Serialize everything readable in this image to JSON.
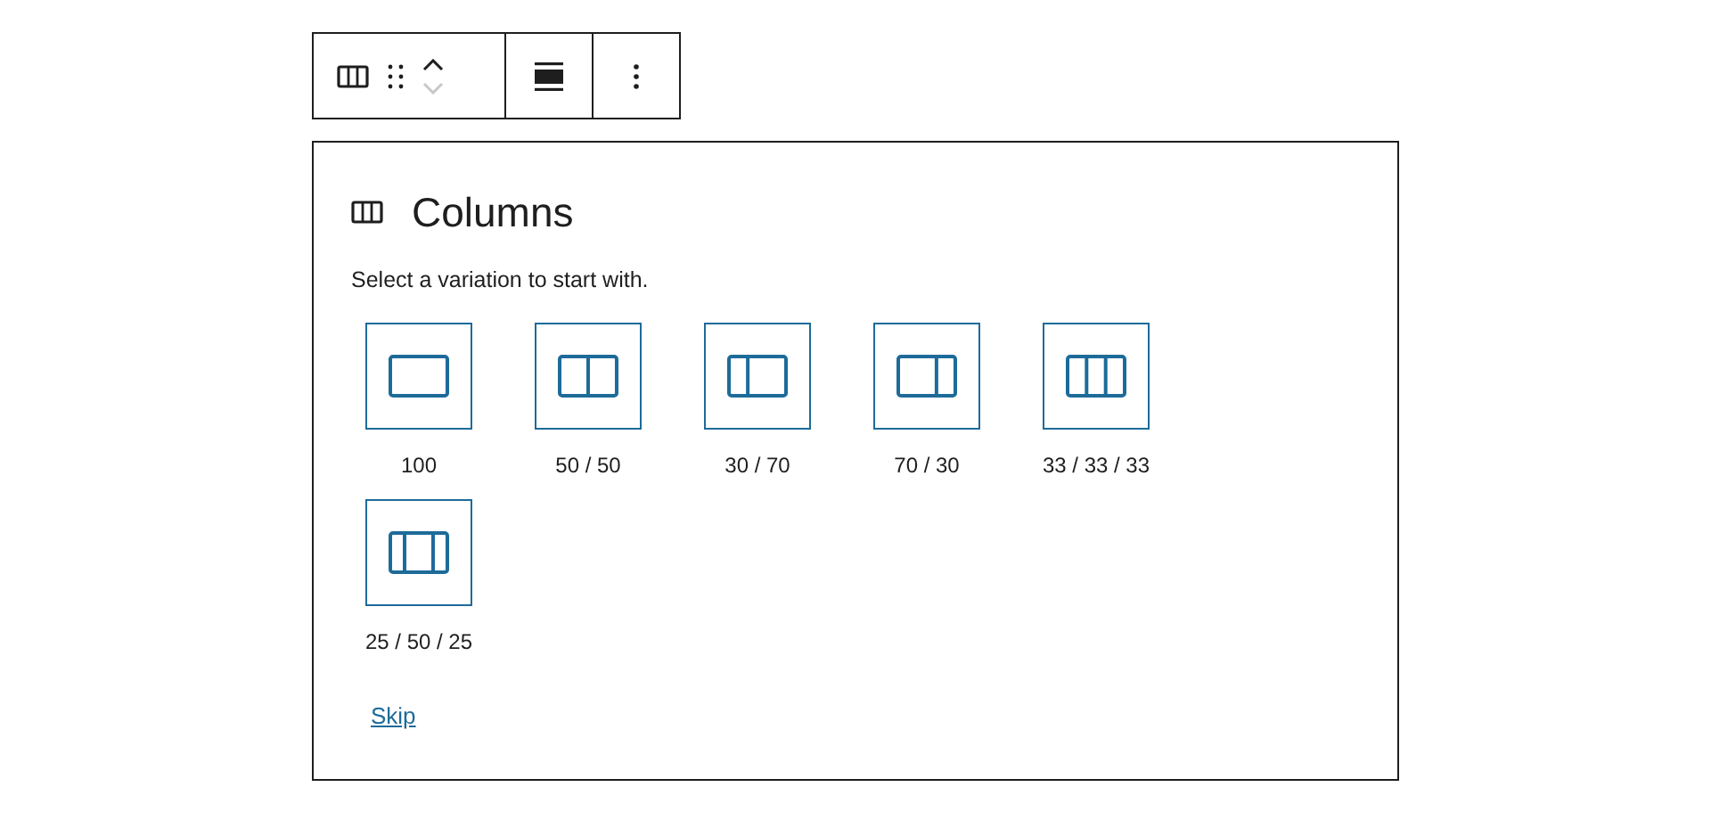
{
  "toolbar": {
    "move_up": {
      "disabled": false
    },
    "move_down": {
      "disabled": true
    }
  },
  "block": {
    "title": "Columns",
    "instructions": "Select a variation to start with.",
    "variations": [
      {
        "label": "100",
        "kind": "full"
      },
      {
        "label": "50 / 50",
        "kind": "halves"
      },
      {
        "label": "30 / 70",
        "kind": "thirty-seventy"
      },
      {
        "label": "70 / 30",
        "kind": "seventy-thirty"
      },
      {
        "label": "33 / 33 / 33",
        "kind": "thirds"
      },
      {
        "label": "25 / 50 / 25",
        "kind": "quarter-half-quarter"
      }
    ],
    "skip": "Skip"
  }
}
